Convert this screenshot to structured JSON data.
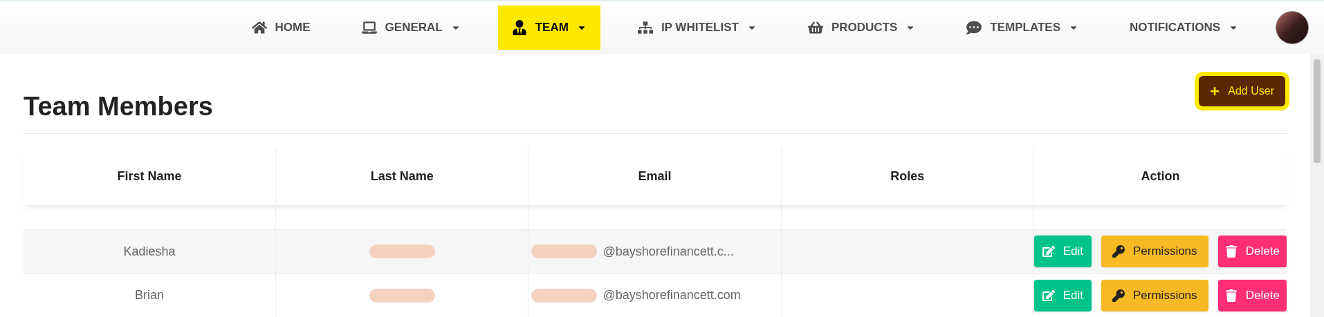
{
  "nav": [
    {
      "label": "HOME",
      "dropdown": false,
      "selected": false
    },
    {
      "label": "GENERAL",
      "dropdown": true,
      "selected": false
    },
    {
      "label": "TEAM",
      "dropdown": true,
      "selected": true
    },
    {
      "label": "IP WHITELIST",
      "dropdown": true,
      "selected": false
    },
    {
      "label": "PRODUCTS",
      "dropdown": true,
      "selected": false
    },
    {
      "label": "TEMPLATES",
      "dropdown": true,
      "selected": false
    },
    {
      "label": "NOTIFICATIONS",
      "dropdown": true,
      "selected": false
    }
  ],
  "page": {
    "title": "Team Members",
    "add_button": "Add User"
  },
  "table": {
    "columns": [
      "First Name",
      "Last Name",
      "Email",
      "Roles",
      "Action"
    ],
    "rows": [
      {
        "first_name": "Kadiesha",
        "last_name_redacted": true,
        "email": "@bayshorefinancett.c...",
        "actions": [
          "Edit",
          "Permissions",
          "Delete"
        ]
      },
      {
        "first_name": "Brian",
        "last_name_redacted": true,
        "email": "@bayshorefinancett.com",
        "actions": [
          "Edit",
          "Permissions",
          "Delete"
        ]
      }
    ]
  }
}
